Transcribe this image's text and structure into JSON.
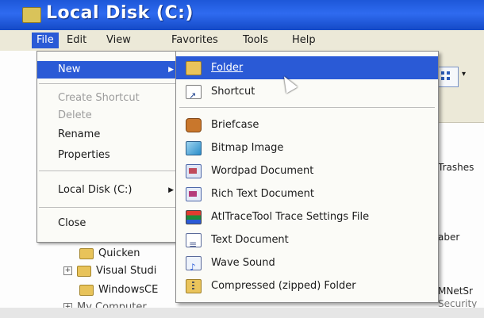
{
  "window": {
    "title": "Local Disk (C:)"
  },
  "menubar": [
    "File",
    "Edit",
    "View",
    "Favorites",
    "Tools",
    "Help"
  ],
  "file_menu": {
    "items": [
      {
        "label": "New",
        "state": "selected",
        "submenu": true
      },
      {
        "label": "Create Shortcut",
        "state": "disabled"
      },
      {
        "label": "Delete",
        "state": "disabled"
      },
      {
        "label": "Rename",
        "state": "normal"
      },
      {
        "label": "Properties",
        "state": "normal"
      },
      {
        "label": "Local Disk (C:)",
        "state": "normal",
        "submenu": true
      },
      {
        "label": "Close",
        "state": "normal"
      }
    ]
  },
  "new_menu": {
    "items": [
      {
        "label": "Folder",
        "icon": "folder-icon",
        "state": "selected"
      },
      {
        "label": "Shortcut",
        "icon": "shortcut-icon",
        "state": "normal"
      },
      {
        "label": "Briefcase",
        "icon": "briefcase-icon",
        "state": "normal"
      },
      {
        "label": "Bitmap Image",
        "icon": "bitmap-icon",
        "state": "normal"
      },
      {
        "label": "Wordpad Document",
        "icon": "wordpad-icon",
        "state": "normal"
      },
      {
        "label": "Rich Text Document",
        "icon": "rtf-icon",
        "state": "normal"
      },
      {
        "label": "AtlTraceTool Trace Settings File",
        "icon": "trace-settings-icon",
        "state": "normal"
      },
      {
        "label": "Text Document",
        "icon": "text-document-icon",
        "state": "normal"
      },
      {
        "label": "Wave Sound",
        "icon": "wave-sound-icon",
        "state": "normal"
      },
      {
        "label": "Compressed (zipped) Folder",
        "icon": "zip-folder-icon",
        "state": "normal"
      }
    ]
  },
  "tree": {
    "items": [
      {
        "label": "Quicken"
      },
      {
        "label": "Visual Studi"
      },
      {
        "label": "WindowsCE"
      },
      {
        "label": "My Computer"
      }
    ]
  },
  "right_pane": {
    "items": [
      "Trashes",
      "aber",
      "MNetSr",
      "Security"
    ]
  },
  "colors": {
    "selection": "#2a5ad6",
    "titlebar": "#1d57d8",
    "menu_bg": "#ece9d8"
  }
}
